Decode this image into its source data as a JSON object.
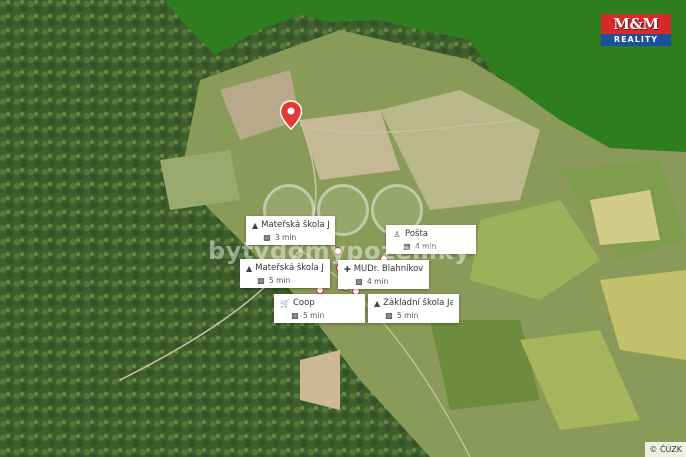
{
  "brand": {
    "logo_top": "M&M",
    "logo_bottom": "REALITY"
  },
  "watermark": "bytydomypozemky",
  "location_pin": {
    "icon": "map-marker-icon",
    "color": "#e53935"
  },
  "pois": [
    {
      "name": "Mateřská škola Ja...",
      "icon": "school-icon",
      "time_icon": "car-icon",
      "time": "3 min"
    },
    {
      "name": "Pošta",
      "icon": "person-icon",
      "time_icon": "car-icon",
      "time": "4 min"
    },
    {
      "name": "Mateřská škola Ja...",
      "icon": "school-icon",
      "time_icon": "car-icon",
      "time": "5 min"
    },
    {
      "name": "MUDr. Blahníkova...",
      "icon": "medical-icon",
      "time_icon": "car-icon",
      "time": "4 min"
    },
    {
      "name": "Coop",
      "icon": "cart-icon",
      "time_icon": "car-icon",
      "time": "5 min"
    },
    {
      "name": "Základní škola Ja...",
      "icon": "school-icon",
      "time_icon": "car-icon",
      "time": "5 min"
    }
  ],
  "attribution": "© ČÚZK",
  "colors": {
    "outside_area": "#2e7d1f",
    "pin": "#e53935",
    "logo_red": "#d72a2a",
    "logo_blue": "#1e4f9a"
  }
}
